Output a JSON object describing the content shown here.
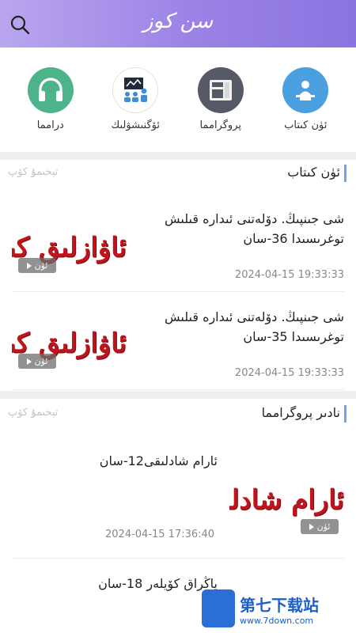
{
  "header": {
    "logo_text": "سن كوز",
    "search_icon": "search-icon"
  },
  "categories": [
    {
      "label": "درامما",
      "icon": "headphones-icon",
      "color": "#4cb38a"
    },
    {
      "label": "ئۆگنىشۋلىك",
      "icon": "classroom-icon",
      "color": "#ffffff"
    },
    {
      "label": "پروگرامما",
      "icon": "radio-icon",
      "color": "#555a66"
    },
    {
      "label": "ئۈن كىتاب",
      "icon": "reader-icon",
      "color": "#4a9fe0"
    }
  ],
  "sections": [
    {
      "title": "ئۈن كىتاب",
      "more": "تېخىمۇ كۆپ",
      "items": [
        {
          "text": "شى جىنپىڭ. دۆلەتنى ئىدارە قىلىش توغرىسىدا 36-سان",
          "date": "2024-04-15 19:33:33",
          "thumb_text": "ئاۋازلىق كىتاب",
          "badge": "ئۈن"
        },
        {
          "text": "شى جىنپىڭ. دۆلەتنى ئىدارە قىلىش توغرىسىدا 35-سان",
          "date": "2024-04-15 19:33:33",
          "thumb_text": "ئاۋازلىق كىتاب",
          "badge": "ئۈن"
        }
      ]
    },
    {
      "title": "نادىر پروگرامما",
      "more": "تېخىمۇ كۆپ",
      "items": [
        {
          "text": "ئارام شادلىقى12-سان",
          "date": "2024-04-15 17:36:40",
          "thumb_text": "ئارام شادلىقى",
          "badge": "ئۈن"
        },
        {
          "text": "ياڭراق كۆيلەر 18-سان",
          "date": "",
          "thumb_text": "",
          "badge": ""
        }
      ]
    }
  ],
  "watermark": {
    "title": "第七下载站",
    "url": "www.7down.com"
  }
}
